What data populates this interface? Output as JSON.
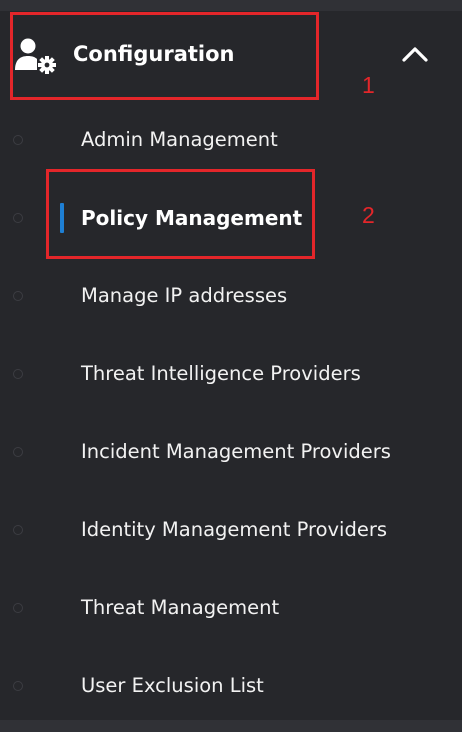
{
  "menu": {
    "header": {
      "title": "Configuration",
      "icon": "user-gear-icon",
      "expanded": true
    },
    "items": [
      {
        "label": "Admin Management",
        "active": false
      },
      {
        "label": "Policy Management",
        "active": true
      },
      {
        "label": "Manage IP addresses",
        "active": false
      },
      {
        "label": "Threat Intelligence Providers",
        "active": false
      },
      {
        "label": "Incident Management Providers",
        "active": false
      },
      {
        "label": "Identity Management Providers",
        "active": false
      },
      {
        "label": "Threat Management",
        "active": false
      },
      {
        "label": "User Exclusion List",
        "active": false
      }
    ]
  },
  "annotations": [
    {
      "label": "1",
      "target": "Configuration"
    },
    {
      "label": "2",
      "target": "Policy Management"
    }
  ],
  "colors": {
    "background": "#26272b",
    "strip": "#303136",
    "text": "#ffffff",
    "active_indicator": "#1e7fd4",
    "annotation": "#e3262a"
  }
}
